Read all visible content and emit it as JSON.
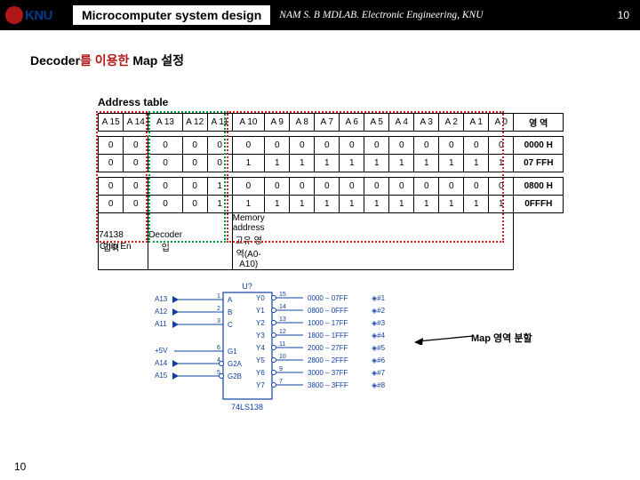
{
  "header": {
    "title": "Microcomputer system design",
    "subtitle": "NAM S. B   MDLAB. Electronic Engineering, KNU",
    "page": "10"
  },
  "logo": {
    "text": "KNU"
  },
  "heading": {
    "prefix": "Decoder",
    "mid": "를 이용한 ",
    "suffix": "Map 설정"
  },
  "subheading": "Address table",
  "table": {
    "headers": [
      "A 15",
      "A 14",
      "A 13",
      "A 12",
      "A 11",
      "A 10",
      "A 9",
      "A 8",
      "A 7",
      "A 6",
      "A 5",
      "A 4",
      "A 3",
      "A 2",
      "A 1",
      "A 0",
      "영 역"
    ],
    "rows": [
      [
        "0",
        "0",
        "0",
        "0",
        "0",
        "0",
        "0",
        "0",
        "0",
        "0",
        "0",
        "0",
        "0",
        "0",
        "0",
        "0",
        "0000 H"
      ],
      [
        "0",
        "0",
        "0",
        "0",
        "0",
        "1",
        "1",
        "1",
        "1",
        "1",
        "1",
        "1",
        "1",
        "1",
        "1",
        "1",
        "07 FFH"
      ],
      [
        "0",
        "0",
        "0",
        "0",
        "1",
        "0",
        "0",
        "0",
        "0",
        "0",
        "0",
        "0",
        "0",
        "0",
        "0",
        "0",
        "0800 H"
      ],
      [
        "0",
        "0",
        "0",
        "0",
        "1",
        "1",
        "1",
        "1",
        "1",
        "1",
        "1",
        "1",
        "1",
        "1",
        "1",
        "1",
        "0FFFH"
      ]
    ],
    "footer_l": "74138 입력",
    "footer_m": "Decoder 입",
    "footer_r": "Memory address 고유 영역(A0-A10)"
  },
  "chip": "Chip En",
  "diag": {
    "ref": "U?",
    "ic": "74LS138",
    "left_pins": [
      "A13",
      "A12",
      "A11",
      "A14",
      "A15"
    ],
    "left_v": "+5V",
    "in_labels": [
      "A",
      "B",
      "C",
      "G1",
      "G2A",
      "G2B"
    ],
    "in_nums": [
      "1",
      "2",
      "3",
      "6",
      "4",
      "5"
    ],
    "out_labels": [
      "Y0",
      "Y1",
      "Y2",
      "Y3",
      "Y4",
      "Y5",
      "Y6",
      "Y7"
    ],
    "out_nums": [
      "15",
      "14",
      "13",
      "12",
      "11",
      "10",
      "9",
      "7"
    ],
    "ranges": [
      "0000 – 07FF",
      "0800 – 0FFF",
      "1000 – 17FF",
      "1800 – 1FFF",
      "2000 – 27FF",
      "2800 – 2FFF",
      "3000 – 37FF",
      "3800 – 3FFF"
    ],
    "hash": [
      "◈#1",
      "◈#2",
      "◈#3",
      "◈#4",
      "◈#5",
      "◈#6",
      "◈#7",
      "◈#8"
    ]
  },
  "maplabel": "Map 영역 분할",
  "page_bottom": "10"
}
